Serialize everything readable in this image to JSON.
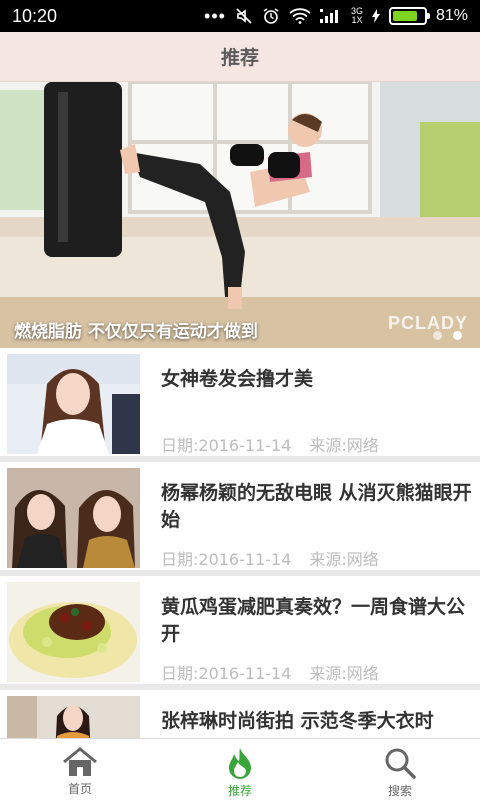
{
  "status_bar": {
    "time": "10:20",
    "network": [
      "3G",
      "1X"
    ],
    "battery_percent": "81%",
    "battery_level": 0.81
  },
  "header": {
    "title": "推荐"
  },
  "banner": {
    "caption": "燃烧脂肪 不仅仅只有运动才做到",
    "watermark": "PCLADY",
    "indicator_count": 2,
    "active_indicator": 1
  },
  "articles": [
    {
      "title": "女神卷发会撸才美",
      "date": "日期:2016-11-14",
      "source": "来源:网络"
    },
    {
      "title": "杨幂杨颖的无敌电眼 从消灭熊猫眼开始",
      "date": "日期:2016-11-14",
      "source": "来源:网络"
    },
    {
      "title": "黄瓜鸡蛋减肥真奏效？一周食谱大公开",
      "date": "日期:2016-11-14",
      "source": "来源:网络"
    },
    {
      "title": "张梓琳时尚街拍 示范冬季大衣时",
      "date": "",
      "source": ""
    }
  ],
  "tabs": [
    {
      "label": "首页",
      "icon": "home-icon",
      "active": false
    },
    {
      "label": "推荐",
      "icon": "flame-icon",
      "active": true
    },
    {
      "label": "搜索",
      "icon": "search-icon",
      "active": false
    }
  ],
  "colors": {
    "accent": "#3aa63a",
    "header_bg": "#f6e6e2"
  }
}
